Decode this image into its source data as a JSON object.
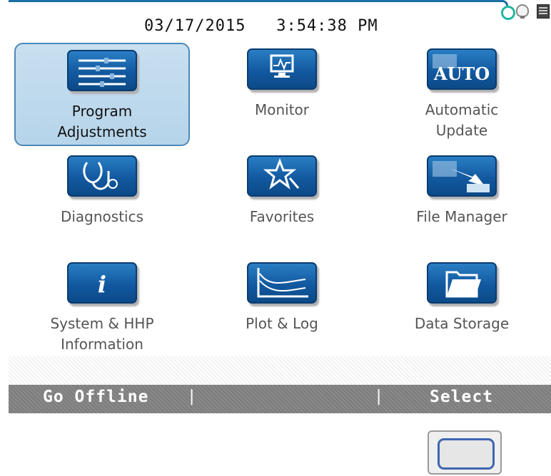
{
  "status_bar": {
    "date": "03/17/2015",
    "time": "3:54:38 PM",
    "icons": [
      "connection-ring-icon",
      "lightbulb-icon",
      "battery-icon"
    ]
  },
  "menu": {
    "items": [
      {
        "id": "program-adjustments",
        "label_line1": "Program",
        "label_line2": "Adjustments",
        "icon": "sliders-icon",
        "selected": true
      },
      {
        "id": "monitor",
        "label_line1": "Monitor",
        "label_line2": "",
        "icon": "monitor-icon",
        "selected": false
      },
      {
        "id": "automatic-update",
        "label_line1": "Automatic",
        "label_line2": "Update",
        "icon": "auto-icon",
        "icon_text": "AUTO",
        "selected": false
      },
      {
        "id": "diagnostics",
        "label_line1": "Diagnostics",
        "label_line2": "",
        "icon": "stethoscope-icon",
        "selected": false
      },
      {
        "id": "favorites",
        "label_line1": "Favorites",
        "label_line2": "",
        "icon": "star-icon",
        "selected": false
      },
      {
        "id": "file-manager",
        "label_line1": "File Manager",
        "label_line2": "",
        "icon": "file-transfer-icon",
        "selected": false
      },
      {
        "id": "system-hhp-information",
        "label_line1": "System & HHP",
        "label_line2": "Information",
        "icon": "info-icon",
        "icon_text": "i",
        "selected": false
      },
      {
        "id": "plot-log",
        "label_line1": "Plot & Log",
        "label_line2": "",
        "icon": "plot-icon",
        "selected": false
      },
      {
        "id": "data-storage",
        "label_line1": "Data Storage",
        "label_line2": "",
        "icon": "folder-icon",
        "selected": false
      }
    ]
  },
  "softkeys": {
    "left": "Go Offline",
    "right": "Select",
    "separator": "|"
  },
  "colors": {
    "icon_blue": "#1259a0",
    "selection_fill": "#c0dbee",
    "softkey_bar": "#848484",
    "status_ring": "#21b8a0"
  }
}
